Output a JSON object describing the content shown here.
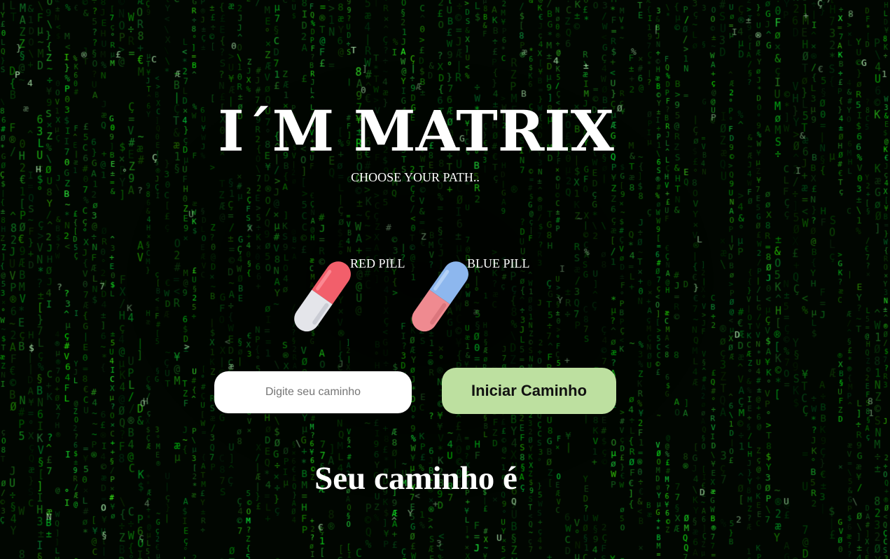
{
  "page": {
    "title": "I´M MATRIX",
    "subtitle": "CHOOSE YOUR PATH.."
  },
  "pills": {
    "red": {
      "label": "RED PILL",
      "icon": "red-pill-icon"
    },
    "blue": {
      "label": "BLUE PILL",
      "icon": "blue-pill-icon"
    }
  },
  "form": {
    "path_placeholder": "Digite seu caminho",
    "path_value": "",
    "start_label": "Iniciar Caminho"
  },
  "result": {
    "text": "Seu caminho é"
  },
  "colors": {
    "matrix_green": "#22c93a",
    "button_green": "#bde0a0",
    "red_pill": "#f25f6b",
    "blue_pill": "#8db7ee"
  }
}
